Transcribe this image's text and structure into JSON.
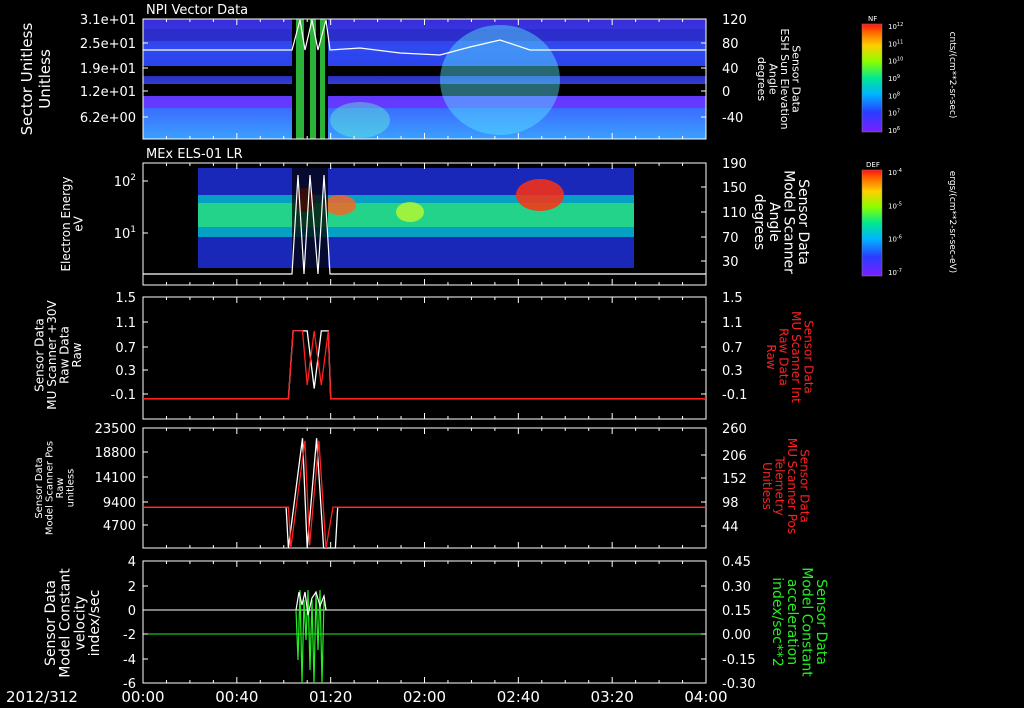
{
  "date_label": "2012/312",
  "time_axis": {
    "start": "00:00",
    "end": "04:00",
    "tick_labels": [
      "00:00",
      "00:40",
      "01:20",
      "02:00",
      "02:40",
      "03:20",
      "04:00"
    ]
  },
  "colors": {
    "white": "#ffffff",
    "red": "#ff2020",
    "green": "#22ee22",
    "frame": "#ffffff"
  },
  "chart_data": [
    {
      "type": "heatmap",
      "title": "NPI Vector Data",
      "ylabel": "Sector Unitless",
      "y_tick_labels": [
        "3.1e+01",
        "2.5e+01",
        "1.9e+01",
        "1.2e+01",
        "6.2e+00"
      ],
      "y2label": [
        "Sensor Data",
        "ESH Sun Elevation",
        "Angle",
        "degrees"
      ],
      "y2_tick_labels": [
        "120",
        "80",
        "40",
        "0",
        "-40"
      ],
      "colorbar": {
        "label": "NF",
        "units": "cnts/(cm**2-sr-sec)",
        "ticks": [
          "10^12",
          "10^11",
          "10^10",
          "10^9",
          "10^8",
          "10^7",
          "10^6"
        ]
      }
    },
    {
      "type": "heatmap",
      "title": "MEx ELS-01 LR",
      "ylabel": [
        "Electron Energy",
        "eV"
      ],
      "y_tick_labels": [
        "10^2",
        "10^1"
      ],
      "y2label": [
        "Sensor Data",
        "Model Scanner",
        "Angle",
        "degrees"
      ],
      "y2_tick_labels": [
        "190",
        "150",
        "110",
        "70",
        "30"
      ],
      "colorbar": {
        "label": "DEF",
        "units": "ergs/(cm**2-sr-sec-eV)",
        "ticks": [
          "10^-4",
          "10^-5",
          "10^-6",
          "10^-7"
        ]
      }
    },
    {
      "type": "line",
      "ylabel": [
        "Sensor Data",
        "MU Scanner +30V",
        "Raw Data",
        "Raw"
      ],
      "ylim": [
        -0.3,
        1.5
      ],
      "y_tick_labels": [
        "1.5",
        "1.1",
        "0.7",
        "0.3",
        "-0.1"
      ],
      "y2label": [
        "Sensor Data",
        "MU Scanner Int",
        "Raw Data",
        "Raw"
      ],
      "y2_tick_labels": [
        "1.5",
        "1.1",
        "0.7",
        "0.3",
        "-0.1"
      ],
      "series": [
        {
          "color": "white",
          "x": [
            "00:00",
            "01:02",
            "01:04",
            "01:10",
            "01:13",
            "01:16",
            "01:19",
            "01:20",
            "04:00"
          ],
          "values": [
            0,
            0,
            1,
            1,
            0.15,
            1,
            1,
            0,
            0
          ]
        },
        {
          "color": "red",
          "x": [
            "00:00",
            "01:02",
            "01:04",
            "01:08",
            "01:10",
            "01:13",
            "01:16",
            "01:19",
            "01:20",
            "04:00"
          ],
          "values": [
            0,
            0,
            1,
            1,
            0.2,
            1,
            0.2,
            1,
            0,
            0
          ]
        }
      ]
    },
    {
      "type": "line",
      "ylabel": [
        "Sensor Data",
        "Model Scanner Pos",
        "Raw",
        "unitless"
      ],
      "ylim": [
        0,
        23500
      ],
      "y_tick_labels": [
        "23500",
        "18800",
        "14100",
        "9400",
        "4700"
      ],
      "y2label": [
        "Sensor Data",
        "MU Scanner Pos",
        "Telemetry",
        "Unitless"
      ],
      "y2_tick_labels": [
        "260",
        "206",
        "152",
        "98",
        "44"
      ],
      "series": [
        {
          "color": "white",
          "x": [
            "00:00",
            "01:01",
            "01:02",
            "01:08",
            "01:10",
            "01:14",
            "01:17",
            "01:22",
            "01:23",
            "04:00"
          ],
          "values": [
            8000,
            8000,
            0,
            21500,
            0,
            21500,
            0,
            0,
            8000,
            8000
          ]
        },
        {
          "color": "red",
          "x": [
            "00:00",
            "01:02",
            "01:03",
            "01:09",
            "01:11",
            "01:15",
            "01:18",
            "01:21",
            "04:00"
          ],
          "values": [
            8000,
            8000,
            0,
            21000,
            500,
            21000,
            0,
            8000,
            8000
          ]
        }
      ]
    },
    {
      "type": "line",
      "ylabel": [
        "Sensor Data",
        "Model Constant",
        "velocity",
        "index/sec"
      ],
      "ylim": [
        -6,
        4
      ],
      "y_tick_labels": [
        "4",
        "2",
        "0",
        "-2",
        "-4",
        "-6"
      ],
      "y2label": [
        "Sensor Data",
        "Model Constant",
        "acceleration",
        "index/sec**2"
      ],
      "y2_tick_labels": [
        "0.45",
        "0.30",
        "0.15",
        "0.00",
        "-0.15",
        "-0.30"
      ],
      "series": [
        {
          "color": "white",
          "name": "velocity",
          "baseline": 0
        },
        {
          "color": "green",
          "name": "acceleration",
          "baseline": 0.0
        }
      ]
    }
  ]
}
